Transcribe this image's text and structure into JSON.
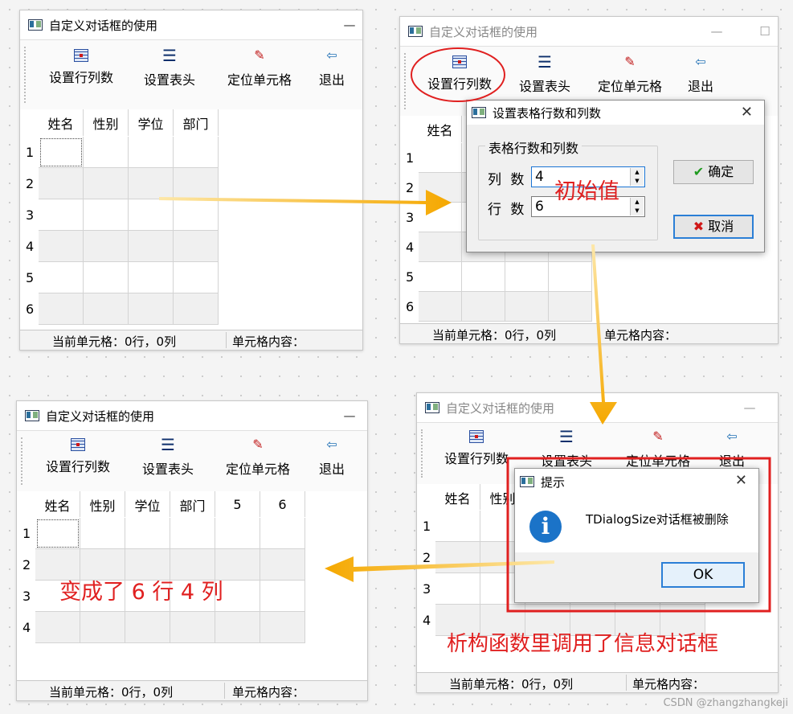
{
  "window_title": "自定义对话框的使用",
  "toolbar": {
    "set_rows_cols": "设置行列数",
    "set_header": "设置表头",
    "locate_cell": "定位单元格",
    "exit": "退出"
  },
  "columns_initial": [
    "姓名",
    "性别",
    "学位",
    "部门"
  ],
  "columns_final": [
    "姓名",
    "性别",
    "学位",
    "部门",
    "5",
    "6"
  ],
  "row_numbers": [
    "1",
    "2",
    "3",
    "4",
    "5",
    "6"
  ],
  "status": {
    "current_cell": "当前单元格：0行，0列",
    "cell_content": "单元格内容："
  },
  "dialog_size": {
    "title": "设置表格行数和列数",
    "group_title": "表格行数和列数",
    "cols_label": "列 数",
    "cols_value": "4",
    "rows_label": "行 数",
    "rows_value": "6",
    "ok": "确定",
    "cancel": "取消"
  },
  "msgbox": {
    "title": "提示",
    "message": "TDialogSize对话框被删除",
    "ok": "OK"
  },
  "annotations": {
    "initial_value": "初始值",
    "result": "变成了 6 行 4 列",
    "destructor_note": "析构函数里调用了信息对话框"
  },
  "watermark": "CSDN @zhangzhangkeji",
  "colors": {
    "annotation_red": "#e02020",
    "arrow_orange": "#f5a800",
    "accent_blue": "#1b73c8"
  }
}
